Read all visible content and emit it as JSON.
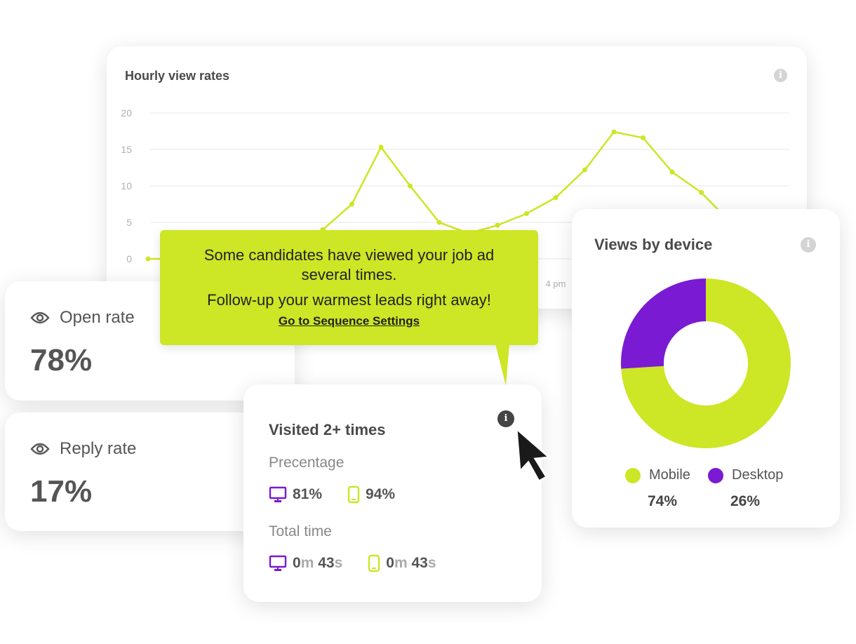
{
  "colors": {
    "accent": "#cde625",
    "desktop": "#7a1ad2",
    "text": "#4d4d4d"
  },
  "chart_data": {
    "type": "line",
    "title": "Hourly view rates",
    "ylim": [
      0,
      20
    ],
    "y_ticks": [
      0,
      5,
      10,
      15,
      20
    ],
    "x_tick_labels": [
      {
        "index": 14,
        "label": "4 pm"
      }
    ],
    "grid": true,
    "series": [
      {
        "color": "#cde625",
        "values": [
          0,
          0,
          0,
          0.5,
          1,
          2,
          4,
          7.5,
          15.3,
          10,
          5,
          3.5,
          4.6,
          6.2,
          8.4,
          12.2,
          17.4,
          16.6,
          11.9,
          9.1,
          5,
          3,
          2
        ]
      }
    ]
  },
  "open_rate": {
    "label": "Open rate",
    "value": "78%",
    "icon": "eye-icon"
  },
  "reply_rate": {
    "label": "Reply rate",
    "value": "17%",
    "icon": "eye-icon"
  },
  "tooltip": {
    "line1": "Some candidates have viewed your job ad several times.",
    "line2": "Follow-up your warmest leads right away!",
    "link": "Go to Sequence Settings"
  },
  "visited": {
    "title": "Visited 2+ times",
    "percentage_label": "Precentage",
    "desktop_pct": "81%",
    "mobile_pct": "94%",
    "time_label": "Total time",
    "desktop_time": {
      "m": "0",
      "m_unit": "m",
      "s": "43",
      "s_unit": "s"
    },
    "mobile_time": {
      "m": "0",
      "m_unit": "m",
      "s": "43",
      "s_unit": "s"
    }
  },
  "device": {
    "title": "Views by device",
    "chart_data": {
      "type": "pie",
      "donut": true,
      "slices": [
        {
          "name": "Mobile",
          "value": 74,
          "color": "#cde625"
        },
        {
          "name": "Desktop",
          "value": 26,
          "color": "#7a1ad2"
        }
      ]
    },
    "mobile_label": "Mobile",
    "mobile_value": "74%",
    "desktop_label": "Desktop",
    "desktop_value": "26%"
  }
}
